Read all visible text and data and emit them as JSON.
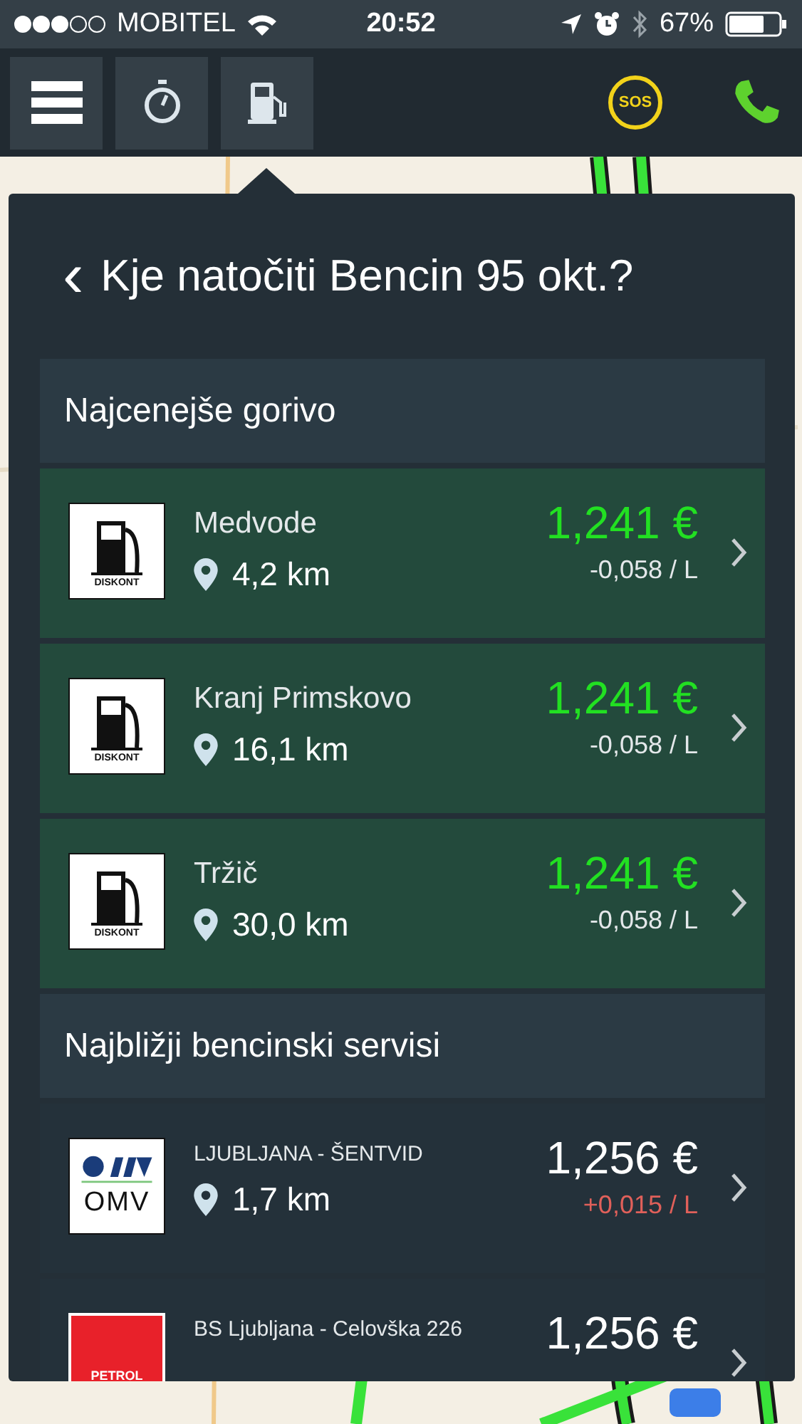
{
  "status_bar": {
    "carrier": "MOBITEL",
    "time": "20:52",
    "battery": "67%"
  },
  "toolbar": {
    "buttons": [
      {
        "kind": "menu",
        "selected": false
      },
      {
        "kind": "stopwatch",
        "selected": false
      },
      {
        "kind": "fuel",
        "selected": true
      }
    ],
    "sos": "SOS"
  },
  "panel": {
    "back": "‹",
    "title": "Kje natočiti Bencin 95 okt.?",
    "sections": [
      {
        "kind": "cheapest",
        "heading": "Najcenejše gorivo",
        "stations": [
          {
            "logo": {
              "kind": "diskont",
              "text": "DISKONT"
            },
            "name": "Medvode",
            "distance": "4,2 km",
            "price": "1,241 €",
            "change": "-0,058 / L",
            "color": "#e4e8ea"
          },
          {
            "logo": {
              "kind": "diskont",
              "text": "DISKONT"
            },
            "name": "Kranj Primskovo",
            "distance": "16,1 km",
            "price": "1,241 €",
            "change": "-0,058 / L",
            "color": "#e4e8ea"
          },
          {
            "logo": {
              "kind": "diskont",
              "text": "DISKONT"
            },
            "name": "Tržič",
            "distance": "30,0 km",
            "price": "1,241 €",
            "change": "-0,058 / L",
            "color": "#e4e8ea"
          }
        ]
      },
      {
        "kind": "nearest",
        "heading": "Najbližji bencinski servisi",
        "stations": [
          {
            "logo": {
              "kind": "omv",
              "text": "OMV"
            },
            "name": "LJUBLJANA - ŠENTVID",
            "distance": "1,7 km",
            "price": "1,256 €",
            "change": "+0,015 / L",
            "color": "#e0605a"
          },
          {
            "logo": {
              "kind": "petrol",
              "text": "PETROL"
            },
            "name": "BS Ljubljana - Celovška 226",
            "price": "1,256 €"
          }
        ]
      }
    ]
  }
}
